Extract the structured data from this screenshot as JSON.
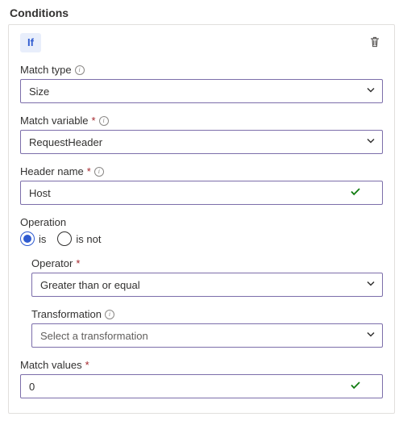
{
  "title": "Conditions",
  "header": {
    "if_label": "If"
  },
  "fields": {
    "match_type": {
      "label": "Match type",
      "value": "Size",
      "required": false,
      "info": true
    },
    "match_variable": {
      "label": "Match variable",
      "value": "RequestHeader",
      "required": true,
      "info": true
    },
    "header_name": {
      "label": "Header name",
      "value": "Host",
      "required": true,
      "info": true,
      "valid": true
    },
    "operation": {
      "label": "Operation",
      "options": [
        "is",
        "is not"
      ],
      "selected": "is"
    },
    "operator": {
      "label": "Operator",
      "value": "Greater than or equal",
      "required": true
    },
    "transformation": {
      "label": "Transformation",
      "info": true,
      "placeholder": "Select a transformation"
    },
    "match_values": {
      "label": "Match values",
      "value": "0",
      "required": true,
      "valid": true
    }
  }
}
